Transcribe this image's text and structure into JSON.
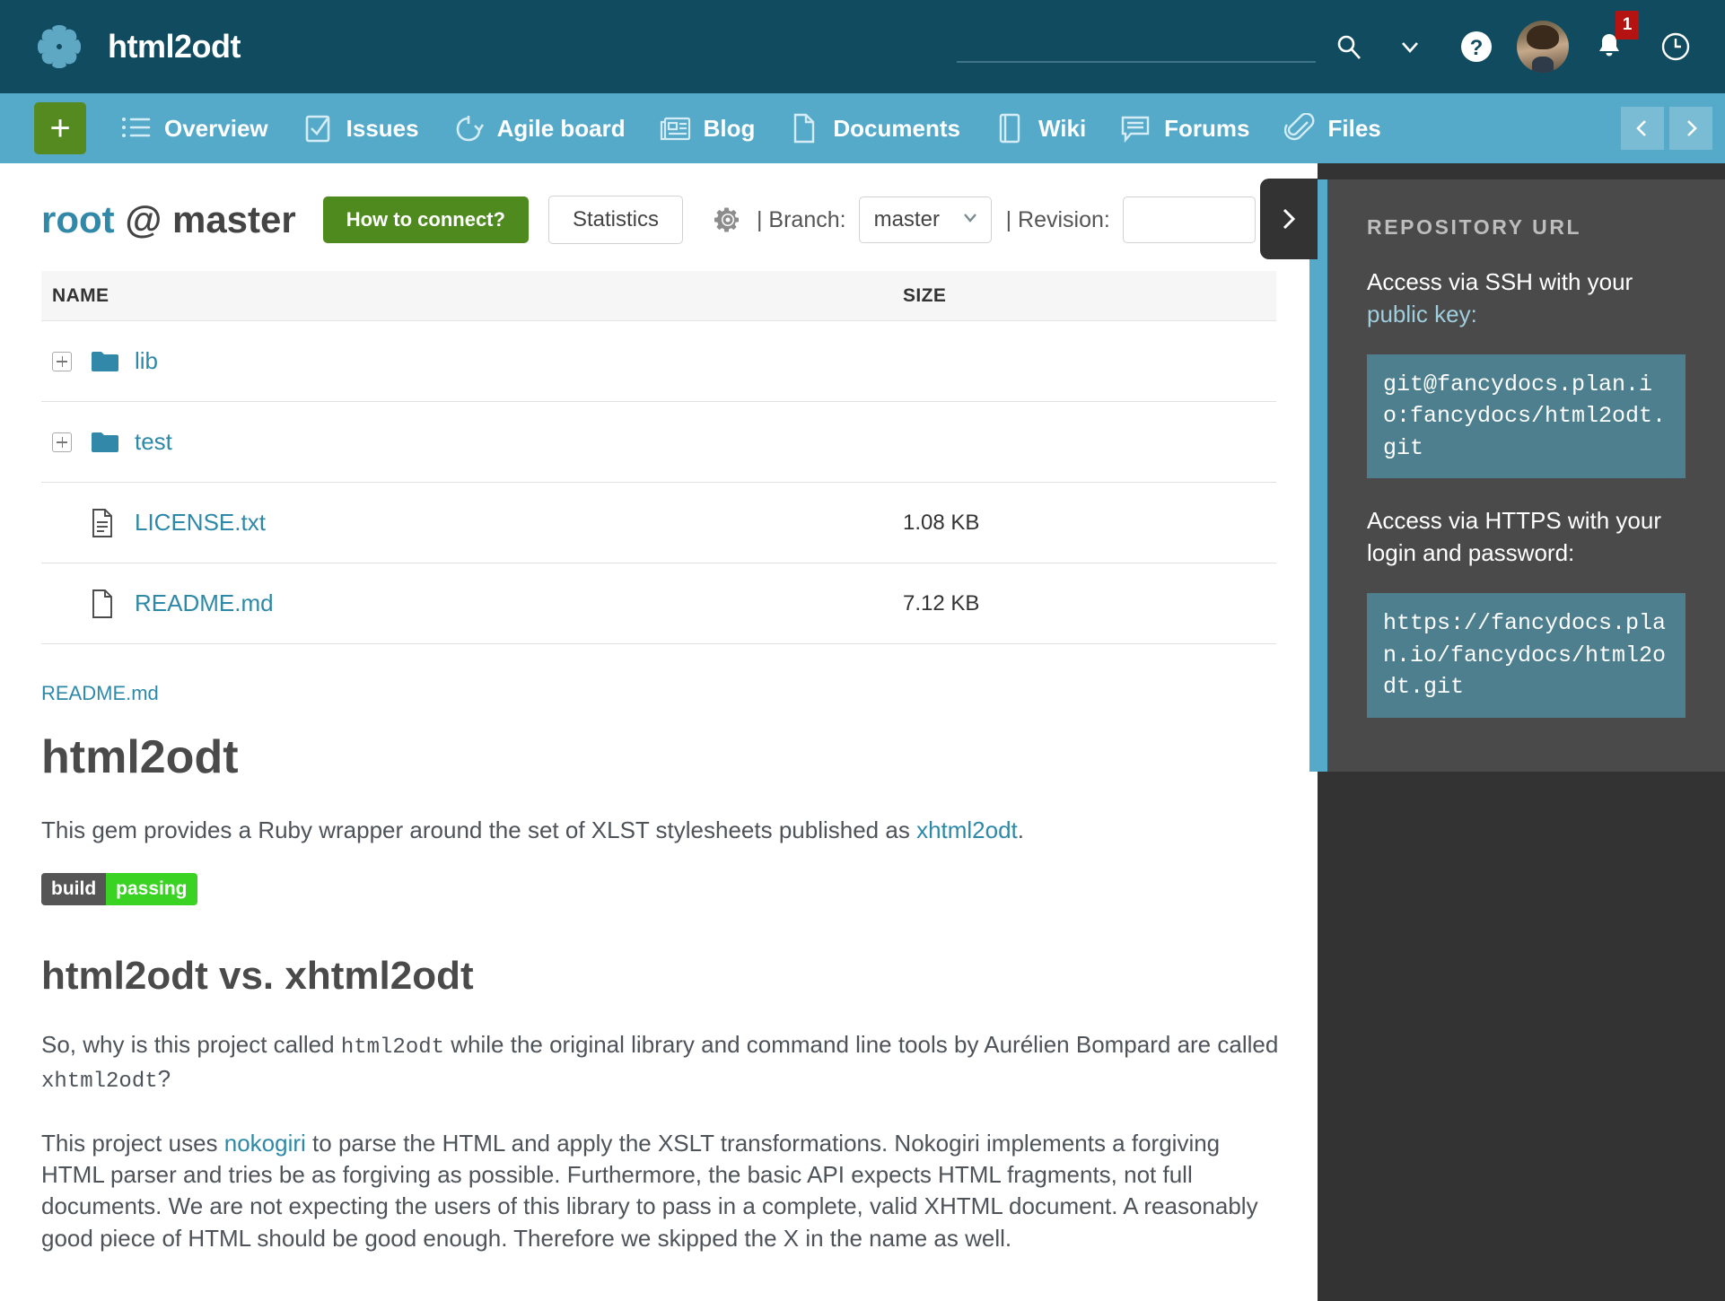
{
  "topbar": {
    "brand_title": "html2odt",
    "logo_icon": "asterisk-logo-icon",
    "search": {
      "value": "",
      "placeholder": ""
    },
    "icons": {
      "search": "search-icon",
      "chevron_down": "chevron-down-icon",
      "help": "help-circle-icon",
      "avatar": "user-avatar",
      "bell": "bell-icon",
      "clock": "clock-icon"
    },
    "notification_count": "1"
  },
  "nav": {
    "add_label": "+",
    "items": [
      {
        "label": "Overview",
        "icon": "list-icon"
      },
      {
        "label": "Issues",
        "icon": "checkbox-icon"
      },
      {
        "label": "Agile board",
        "icon": "cycle-arrow-icon"
      },
      {
        "label": "Blog",
        "icon": "newspaper-icon"
      },
      {
        "label": "Documents",
        "icon": "document-icon"
      },
      {
        "label": "Wiki",
        "icon": "book-icon"
      },
      {
        "label": "Forums",
        "icon": "speech-bubble-icon"
      },
      {
        "label": "Files",
        "icon": "paperclip-icon"
      }
    ],
    "prev_icon": "chevron-left-icon",
    "next_icon": "chevron-right-icon"
  },
  "toolbar": {
    "repo_root": "root",
    "repo_at": "@",
    "repo_branch": "master",
    "how_to_connect": "How to connect?",
    "statistics": "Statistics",
    "settings_icon": "gear-icon",
    "branch_label": "| Branch:",
    "branch_value": "master",
    "revision_label": "| Revision:",
    "revision_value": "",
    "revision_placeholder": ""
  },
  "file_table": {
    "columns": [
      "NAME",
      "SIZE"
    ],
    "rows": [
      {
        "name": "lib",
        "size": "",
        "type": "folder",
        "icon": "folder-icon",
        "expandable": true
      },
      {
        "name": "test",
        "size": "",
        "type": "folder",
        "icon": "folder-icon",
        "expandable": true
      },
      {
        "name": "LICENSE.txt",
        "size": "1.08 KB",
        "type": "file",
        "icon": "text-file-icon",
        "expandable": false
      },
      {
        "name": "README.md",
        "size": "7.12 KB",
        "type": "file",
        "icon": "blank-file-icon",
        "expandable": false
      }
    ]
  },
  "readme": {
    "source_link": "README.md",
    "title": "html2odt",
    "intro_before": "This gem provides a Ruby wrapper around the set of XLST stylesheets published as ",
    "intro_link": "xhtml2odt",
    "intro_after": ".",
    "build_badge": {
      "key": "build",
      "value": "passing"
    },
    "section_title": "html2odt vs. xhtml2odt",
    "para2_a": "So, why is this project called ",
    "para2_code1": "html2odt",
    "para2_b": " while the original library and command line tools by Aurélien Bompard are called ",
    "para2_code2": "xhtml2odt",
    "para2_c": "?",
    "para3_a": "This project uses ",
    "para3_link": "nokogiri",
    "para3_b": " to parse the HTML and apply the XSLT transformations. Nokogiri implements a forgiving HTML parser and tries be as forgiving as possible. Furthermore, the basic API expects HTML fragments, not full documents. We are not expecting the users of this library to pass in a complete, valid XHTML document. A reasonably good piece of HTML should be good enough. Therefore we skipped the X in the name as well."
  },
  "sidebar": {
    "heading": "REPOSITORY URL",
    "ssh_text_main": "Access via SSH with your ",
    "ssh_text_link": "public key:",
    "ssh_url": "git@fancydocs.plan.io:fancydocs/html2odt.git",
    "https_text": "Access via HTTPS with your login and password:",
    "https_url": "https://fancydocs.plan.io/fancydocs/html2odt.git",
    "toggle_icon": "chevron-right-icon"
  },
  "colors": {
    "topbar": "#114b60",
    "navbar": "#56aac9",
    "accent_green": "#4f8a1f",
    "link": "#2e89a8",
    "sidebar_panel": "#4a4a4a",
    "sidebar_backdrop": "#333333",
    "code_block": "#4d7f8f",
    "badge_red": "#b51212",
    "badge_green": "#3ad324"
  }
}
